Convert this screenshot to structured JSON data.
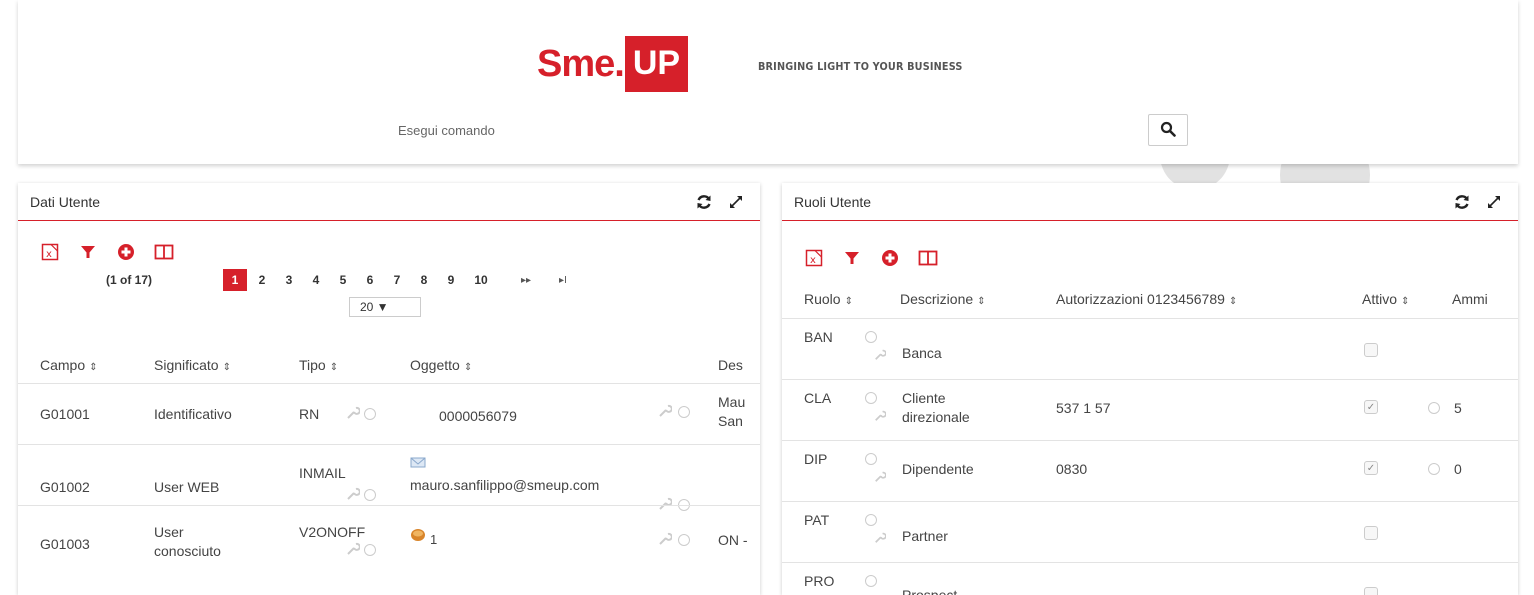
{
  "header": {
    "logo_sme": "Sme",
    "logo_dot": ".",
    "logo_up": "UP",
    "tagline": "BRINGING LIGHT TO YOUR BUSINESS",
    "command_label": "Esegui comando"
  },
  "left_panel": {
    "title": "Dati Utente",
    "pager_info": "(1 of 17)",
    "pages": [
      "1",
      "2",
      "3",
      "4",
      "5",
      "6",
      "7",
      "8",
      "9",
      "10"
    ],
    "active_page": "1",
    "next": "▸▸",
    "last": "▸I",
    "rows_per_page": "20 ▼",
    "columns": [
      "Campo",
      "Significato",
      "Tipo",
      "Oggetto",
      "Des"
    ],
    "rows": [
      {
        "campo": "G01001",
        "significato": "Identificativo",
        "significato2": "",
        "tipo": "RN",
        "oggetto": "0000056079",
        "des": "Mau",
        "des2": "San"
      },
      {
        "campo": "G01002",
        "significato": "User WEB",
        "significato2": "",
        "tipo": "INMAIL",
        "oggetto": "mauro.sanfilippo@smeup.com",
        "des": "",
        "des2": ""
      },
      {
        "campo": "G01003",
        "significato": "User",
        "significato2": "conosciuto",
        "tipo": "V2ONOFF",
        "oggetto": "1",
        "des": "ON -",
        "des2": ""
      }
    ]
  },
  "right_panel": {
    "title": "Ruoli Utente",
    "columns": [
      "Ruolo",
      "Descrizione",
      "Autorizzazioni 0123456789",
      "Attivo",
      "Ammi"
    ],
    "rows": [
      {
        "ruolo": "BAN",
        "descrizione": "Banca",
        "descrizione2": "",
        "autorizzazioni": "",
        "attivo": false,
        "ammi": ""
      },
      {
        "ruolo": "CLA",
        "descrizione": "Cliente",
        "descrizione2": "direzionale",
        "autorizzazioni": "537 1 57",
        "attivo": true,
        "ammi": "5"
      },
      {
        "ruolo": "DIP",
        "descrizione": "Dipendente",
        "descrizione2": "",
        "autorizzazioni": "0830",
        "attivo": true,
        "ammi": "0"
      },
      {
        "ruolo": "PAT",
        "descrizione": "Partner",
        "descrizione2": "",
        "autorizzazioni": "",
        "attivo": false,
        "ammi": ""
      },
      {
        "ruolo": "PRO",
        "descrizione": "Prospect",
        "descrizione2": "",
        "autorizzazioni": "",
        "attivo": false,
        "ammi": ""
      }
    ]
  },
  "colors": {
    "accent": "#d6202a",
    "border": "#e3e3e3"
  },
  "icons": [
    "search-icon",
    "refresh-icon",
    "expand-icon",
    "excel-export-icon",
    "filter-icon",
    "add-icon",
    "columns-icon",
    "wrench-icon",
    "radio-icon",
    "checkbox-icon",
    "email-icon",
    "toggle-icon"
  ]
}
